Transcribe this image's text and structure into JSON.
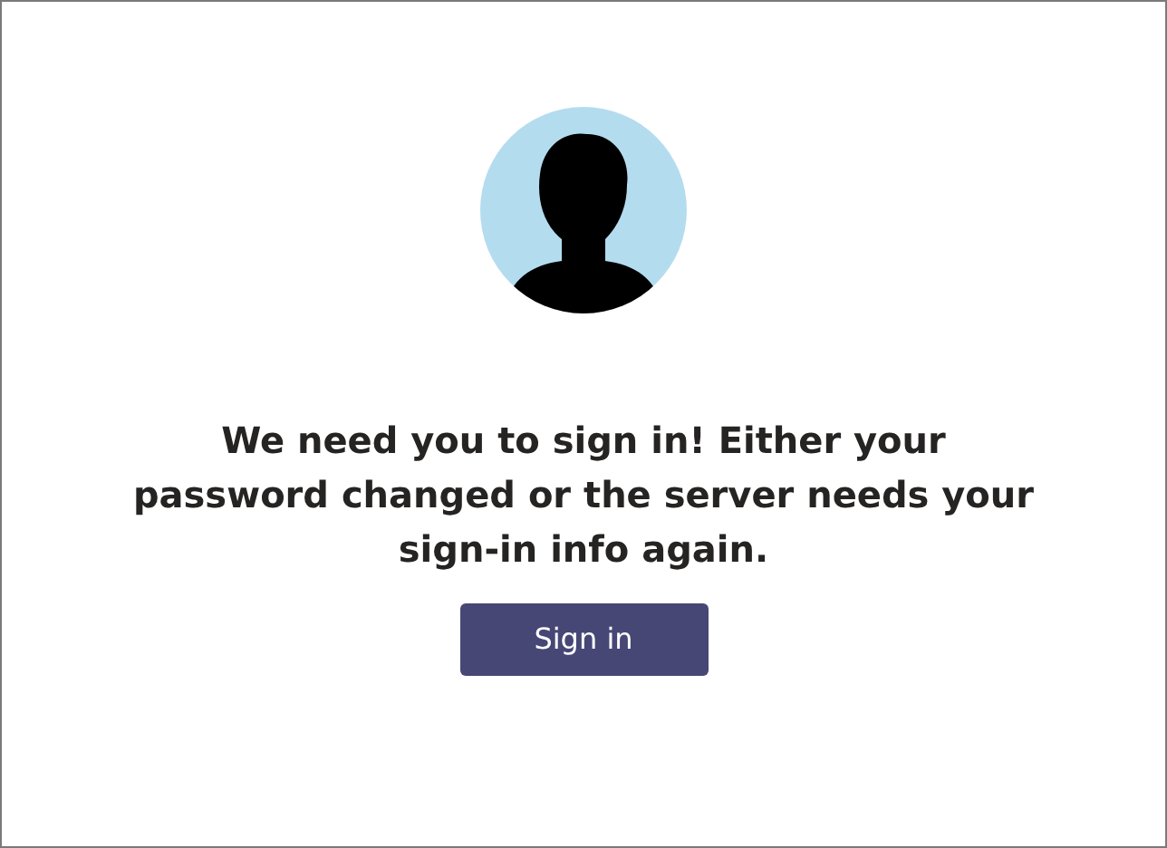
{
  "message": "We need you to sign in! Either your password changed or the server needs your sign-in info again.",
  "buttons": [
    {
      "label": "Sign in"
    }
  ]
}
